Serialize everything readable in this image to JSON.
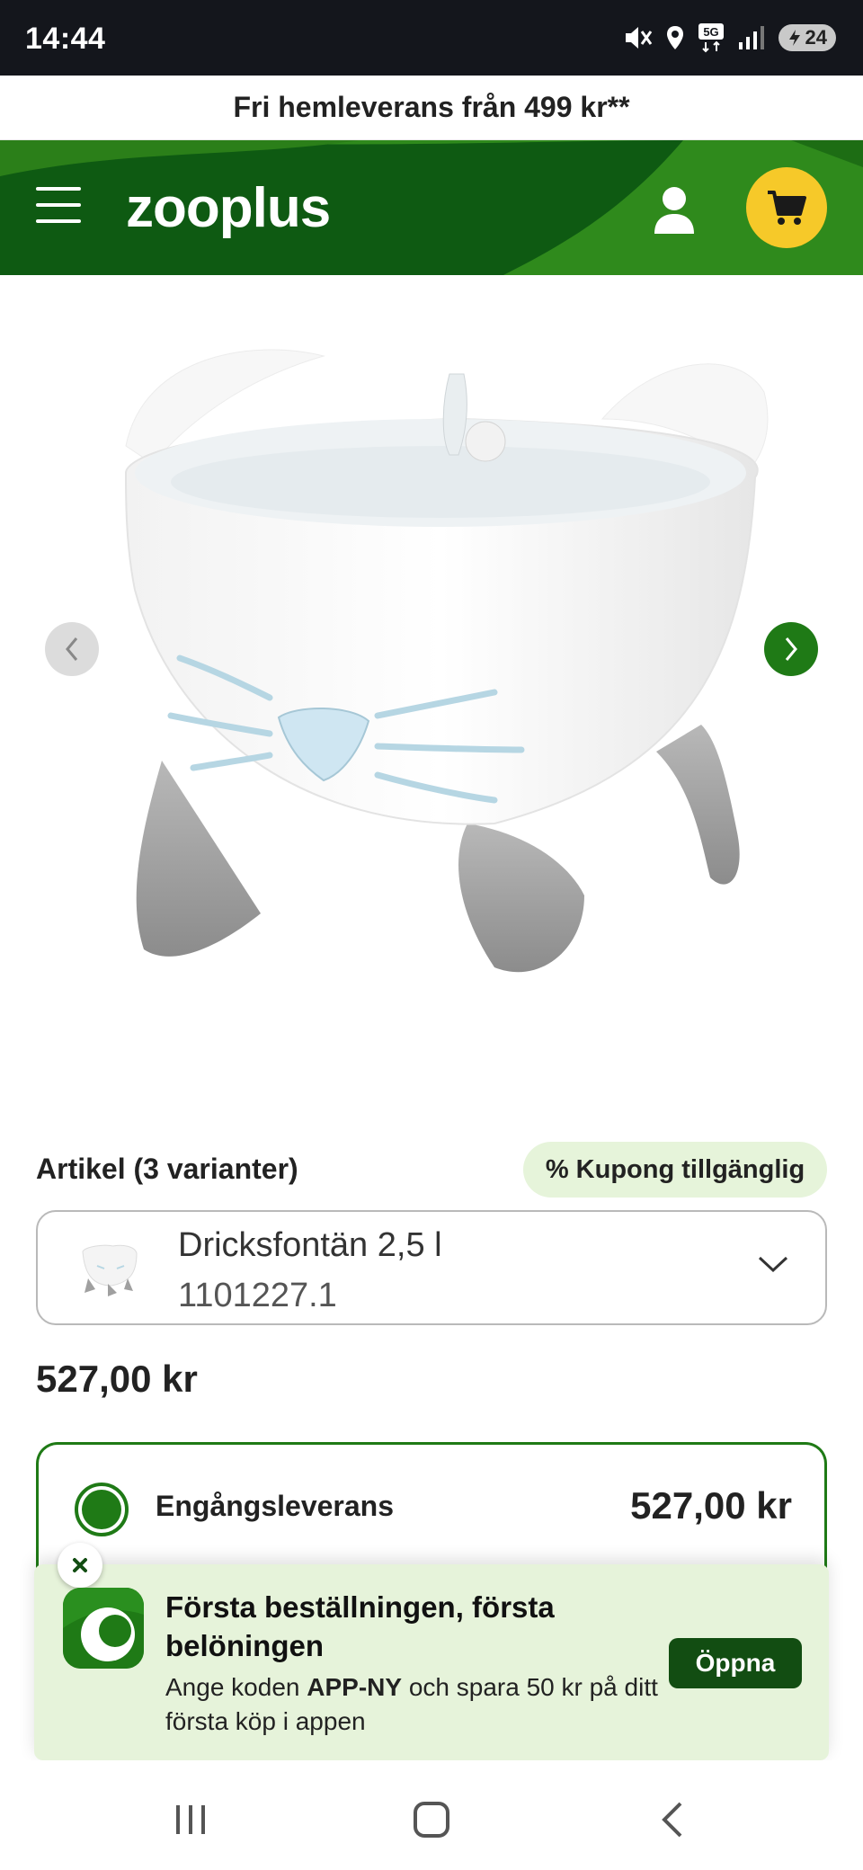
{
  "status_bar": {
    "time": "14:44",
    "icons": [
      "mute-icon",
      "location-icon",
      "5g-icon",
      "signal-icon"
    ],
    "battery": "24"
  },
  "promo_strip": {
    "text": "Fri hemleverans från 499 kr**"
  },
  "header": {
    "logo": "zooplus",
    "icons": [
      "menu-icon",
      "user-icon",
      "cart-icon"
    ],
    "brand_color": "#0e5a12",
    "accent_color": "#f6c929"
  },
  "gallery": {
    "prev_icon": "chevron-left-icon",
    "next_icon": "chevron-right-icon"
  },
  "variant": {
    "title": "Artikel (3 varianter)",
    "coupon": "% Kupong tillgänglig",
    "selected_name": "Dricksfontän 2,5 l",
    "selected_code": "1101227.1"
  },
  "price": "527,00 kr",
  "delivery": {
    "label": "Engångsleverans",
    "price": "527,00 kr"
  },
  "app_banner": {
    "title": "Första beställningen, första belöningen",
    "text_before": "Ange koden ",
    "code": "APP-NY",
    "text_after": " och spara 50 kr på ditt första köp i appen",
    "button": "Öppna"
  },
  "bottom_nav": [
    "recent-apps-icon",
    "home-icon",
    "back-icon"
  ]
}
